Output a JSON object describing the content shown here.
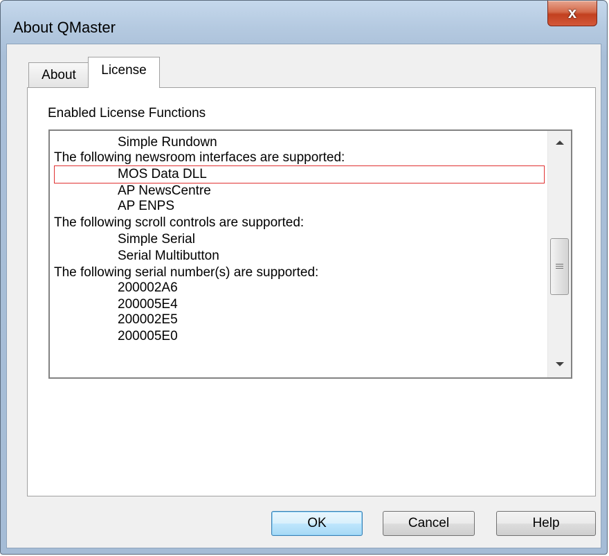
{
  "window": {
    "title": "About QMaster",
    "close_label": "x"
  },
  "tabs": [
    {
      "label": "About",
      "selected": false
    },
    {
      "label": "License",
      "selected": true
    }
  ],
  "license": {
    "group_label": "Enabled License Functions",
    "lines": [
      {
        "text": "Simple Rundown",
        "indent": 1
      },
      {
        "text": "The following newsroom interfaces are supported:",
        "indent": 0
      },
      {
        "text": "MOS Data DLL",
        "indent": 1,
        "highlighted": true
      },
      {
        "text": "AP NewsCentre",
        "indent": 1
      },
      {
        "text": "AP ENPS",
        "indent": 1
      },
      {
        "text": "The following scroll controls are supported:",
        "indent": 0
      },
      {
        "text": "Simple Serial",
        "indent": 1
      },
      {
        "text": "Serial Multibutton",
        "indent": 1
      },
      {
        "text": "The following serial number(s) are supported:",
        "indent": 0
      },
      {
        "text": "200002A6",
        "indent": 1
      },
      {
        "text": "200005E4",
        "indent": 1
      },
      {
        "text": "200002E5",
        "indent": 1
      },
      {
        "text": "200005E0",
        "indent": 1
      }
    ]
  },
  "buttons": {
    "ok": "OK",
    "cancel": "Cancel",
    "help": "Help"
  },
  "colors": {
    "highlight_border": "#e03030",
    "default_button_border": "#3c7fb1"
  }
}
